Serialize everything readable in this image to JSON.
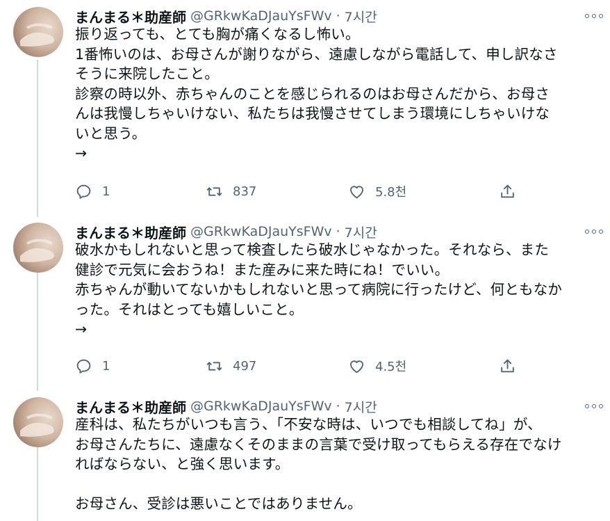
{
  "tweets": [
    {
      "author_name": "まんまる＊助産師",
      "handle": "@GRkwKaDJauYsFWv",
      "separator": "·",
      "time": "7시간",
      "lines": [
        "振り返っても、とても胸が痛くなるし怖い。",
        "1番怖いのは、お母さんが謝りながら、遠慮しながら電話して、申し訳なさ",
        "そうに来院したこと。",
        "診察の時以外、赤ちゃんのことを感じられるのはお母さんだから、お母さ",
        "んは我慢しちゃいけない、私たちは我慢させてしまう環境にしちゃいけな",
        "いと思う。",
        "→"
      ],
      "reply_count": "1",
      "retweet_count": "837",
      "like_count": "5.8천"
    },
    {
      "author_name": "まんまる＊助産師",
      "handle": "@GRkwKaDJauYsFWv",
      "separator": "·",
      "time": "7시간",
      "lines": [
        "破水かもしれないと思って検査したら破水じゃなかった。それなら、また",
        "健診で元気に会おうね！また産みに来た時にね！でいい。",
        "赤ちゃんが動いてないかもしれないと思って病院に行ったけど、何ともなか",
        "った。それはとっても嬉しいこと。",
        "→"
      ],
      "reply_count": "1",
      "retweet_count": "497",
      "like_count": "4.5천"
    },
    {
      "author_name": "まんまる＊助産師",
      "handle": "@GRkwKaDJauYsFWv",
      "separator": "·",
      "time": "7시간",
      "lines": [
        "産科は、私たちがいつも言う、「不安な時は、いつでも相談してね」が、",
        "お母さんたちに、遠慮なくそのままの言葉で受け取ってもらえる存在でなけ",
        "ればならない、と強く思います。",
        "",
        "お母さん、受診は悪いことではありません。"
      ]
    }
  ],
  "icons": {
    "reply": "reply-icon",
    "retweet": "retweet-icon",
    "like": "heart-icon",
    "share": "share-icon",
    "more": "more-icon"
  },
  "colors": {
    "text": "#0f1419",
    "secondary": "#536471",
    "thread_line": "#cfd9de"
  }
}
